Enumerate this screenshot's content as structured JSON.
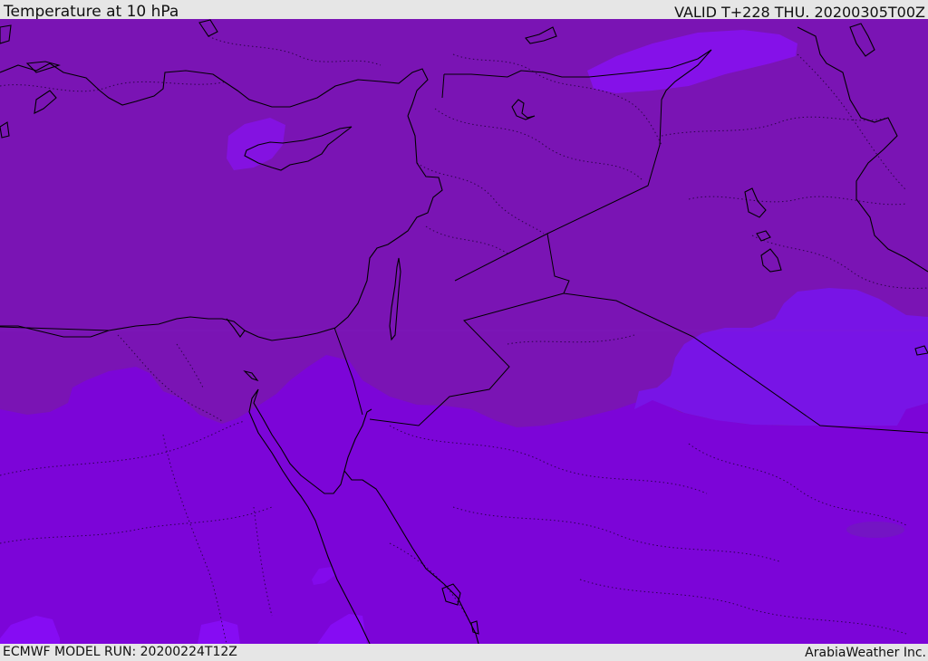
{
  "header": {
    "title": "Temperature at 10 hPa",
    "valid_time": "VALID T+228 THU. 20200305T00Z"
  },
  "footer": {
    "model_run": "ECMWF MODEL RUN: 20200224T12Z",
    "credit": "ArabiaWeather Inc."
  },
  "map": {
    "region": "Eastern Mediterranean / Middle East",
    "colors": {
      "band_cold_north": "#7a14b4",
      "band_south": "#7c05d8",
      "pocket_violet": "#7814e6",
      "patch_bright": "#8a10ff",
      "small_dark_patch": "#7414c4",
      "coastline": "#000000"
    }
  }
}
